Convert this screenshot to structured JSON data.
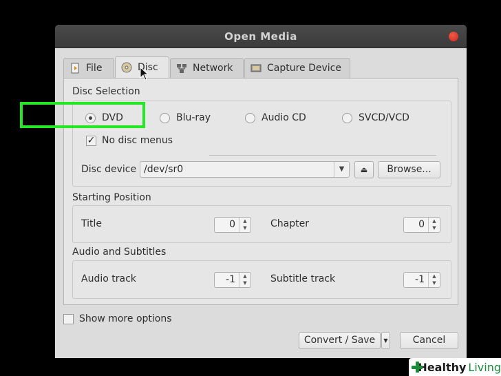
{
  "window": {
    "title": "Open Media"
  },
  "tabs": [
    {
      "label": "File",
      "icon": "file-icon"
    },
    {
      "label": "Disc",
      "icon": "disc-icon"
    },
    {
      "label": "Network",
      "icon": "network-icon"
    },
    {
      "label": "Capture Device",
      "icon": "capture-device-icon"
    }
  ],
  "disc_selection": {
    "title": "Disc Selection",
    "options": [
      "DVD",
      "Blu-ray",
      "Audio CD",
      "SVCD/VCD"
    ],
    "selected": "DVD",
    "no_disc_menus_label": "No disc menus",
    "no_disc_menus_checked": "✓",
    "device_label": "Disc device",
    "device_value": "/dev/sr0",
    "browse_label": "Browse..."
  },
  "starting_position": {
    "title": "Starting Position",
    "title_label": "Title",
    "title_value": "0",
    "chapter_label": "Chapter",
    "chapter_value": "0"
  },
  "audio_subtitles": {
    "title": "Audio and Subtitles",
    "audio_label": "Audio track",
    "audio_value": "-1",
    "subtitle_label": "Subtitle track",
    "subtitle_value": "-1"
  },
  "footer": {
    "show_more_label": "Show more options",
    "convert_label": "Convert / Save",
    "cancel_label": "Cancel"
  },
  "watermark": {
    "brand_bold": "Healthy",
    "brand_light": "Living"
  },
  "colors": {
    "highlight": "#23e823",
    "close": "#d9392b",
    "brand": "#1b8a3b"
  }
}
